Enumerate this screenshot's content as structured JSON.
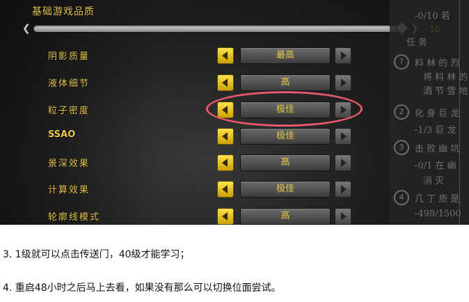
{
  "settings": {
    "title": "基础游戏品质",
    "slider_value": "10",
    "slider_level": 1.0,
    "rows": [
      {
        "label": "阴影质量",
        "value": "最高"
      },
      {
        "label": "液体细节",
        "value": "高"
      },
      {
        "label": "粒子密度",
        "value": "极佳"
      },
      {
        "label": "SSAO",
        "value": "极佳"
      },
      {
        "label": "景深效果",
        "value": "高"
      },
      {
        "label": "计算效果",
        "value": "极佳"
      },
      {
        "label": "轮廓线模式",
        "value": "高"
      }
    ]
  },
  "side_panel": {
    "lines": [
      "-0/10 若 ",
      "任 务",
      "料 林 的 烈",
      "将 料 林 的",
      "酒 节 雪 地",
      "化 身 巨 龙",
      "-1/3 巨 龙",
      "击 败 幽 坑",
      "-0/1 在 幽",
      "消 灭",
      "几 丁 质 是",
      "-498/1500"
    ],
    "numbers": [
      "?",
      "2",
      "3",
      "4"
    ]
  },
  "captions": [
    "3. 1级就可以点击传送门，40级才能学习；",
    "4.  重启48小时之后马上去看，如果没有那么可以切换位面尝试。"
  ]
}
